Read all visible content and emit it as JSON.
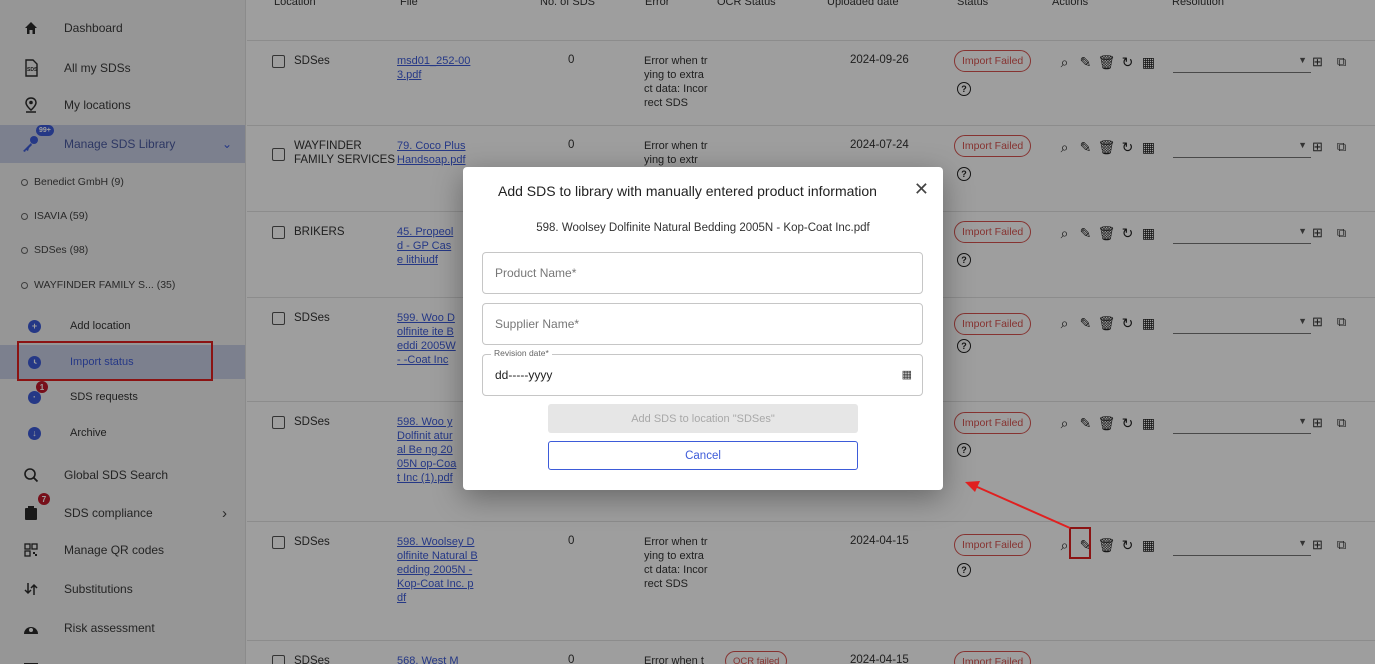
{
  "sidebar": {
    "items": [
      {
        "label": "Dashboard",
        "icon": "home-icon"
      },
      {
        "label": "All my SDSs",
        "icon": "sds-document-icon"
      },
      {
        "label": "My locations",
        "icon": "location-pin-icon"
      },
      {
        "label": "Manage SDS Library",
        "icon": "key-icon",
        "badge": "99+"
      },
      {
        "label": "Global SDS Search",
        "icon": "global-search-icon"
      },
      {
        "label": "SDS compliance",
        "icon": "clipboard-icon",
        "badge": "7"
      },
      {
        "label": "Manage QR codes",
        "icon": "qr-code-icon"
      },
      {
        "label": "Substitutions",
        "icon": "swap-icon"
      },
      {
        "label": "Risk assessment",
        "icon": "hazard-icon"
      }
    ],
    "libraries": [
      {
        "label": "Benedict GmbH (9)"
      },
      {
        "label": "ISAVIA (59)"
      },
      {
        "label": "SDSes (98)"
      },
      {
        "label": "WAYFINDER FAMILY S... (35)"
      }
    ],
    "library_actions": [
      {
        "label": "Add location",
        "icon": "add-icon"
      },
      {
        "label": "Import status",
        "icon": "clock-icon"
      },
      {
        "label": "SDS requests",
        "icon": "request-icon",
        "badge": "1"
      },
      {
        "label": "Archive",
        "icon": "archive-icon"
      }
    ]
  },
  "table": {
    "headers": {
      "location": "Location",
      "file": "File",
      "no_of_sds": "No. of SDS",
      "error": "Error",
      "ocr_status": "OCR Status",
      "uploaded_date": "Uploaded date",
      "status": "Status",
      "actions": "Actions",
      "resolution": "Resolution"
    },
    "rows": [
      {
        "location": "SDSes",
        "file": "msd01_252-003.pdf",
        "count": "0",
        "error": "Error when trying to extract data: Incorrect SDS",
        "date": "2024-09-26",
        "status": "Import Failed"
      },
      {
        "location": "WAYFINDER FAMILY SERVICES",
        "file": "79. Coco Plus Handsoap.pdf",
        "count": "0",
        "error": "Error when trying to extr",
        "date": "2024-07-24",
        "status": "Import Failed"
      },
      {
        "location": "BRIKERS",
        "file": "45. Propeold - GP Case lithiudf",
        "count": "",
        "error": "",
        "date": "",
        "status": "Import Failed"
      },
      {
        "location": "SDSes",
        "file": "599. Woo Dolfinite ite Beddi 2005W - -Coat Inc",
        "count": "",
        "error": "",
        "date": "",
        "status": "Import Failed"
      },
      {
        "location": "SDSes",
        "file": "598. Woo y Dolfinit atural Be ng 2005N op-Coat Inc (1).pdf",
        "count": "",
        "error": "",
        "date": "",
        "status": "Import Failed"
      },
      {
        "location": "SDSes",
        "file": "598. Woolsey Dolfinite Natural Bedding 2005N - Kop-Coat Inc. pdf",
        "count": "0",
        "error": "Error when trying to extract data: Incorrect SDS",
        "date": "2024-04-15",
        "status": "Import Failed"
      },
      {
        "location": "SDSes",
        "file": "568. West M",
        "count": "0",
        "error": "Error when t",
        "ocr": "OCR failed",
        "date": "2024-04-15",
        "status": "Import Failed"
      }
    ]
  },
  "modal": {
    "title": "Add SDS to library with manually entered product information",
    "file_name": "598. Woolsey Dolfinite Natural Bedding 2005N - Kop-Coat Inc.pdf",
    "product_placeholder": "Product Name*",
    "supplier_placeholder": "Supplier Name*",
    "revision_label": "Revision date*",
    "revision_value": "dd-----yyyy",
    "add_button": "Add SDS to location \"SDSes\"",
    "cancel_button": "Cancel"
  },
  "glyphs": {
    "chevron_down": "⌄",
    "chevron_right": "›",
    "close": "✕",
    "qmark": "?",
    "caret": "▼",
    "calendar": "▦"
  },
  "colors": {
    "accent": "#3d5bd9",
    "error": "#d9534f",
    "annotation": "#e02020",
    "active_bg": "#c9cfe6"
  }
}
